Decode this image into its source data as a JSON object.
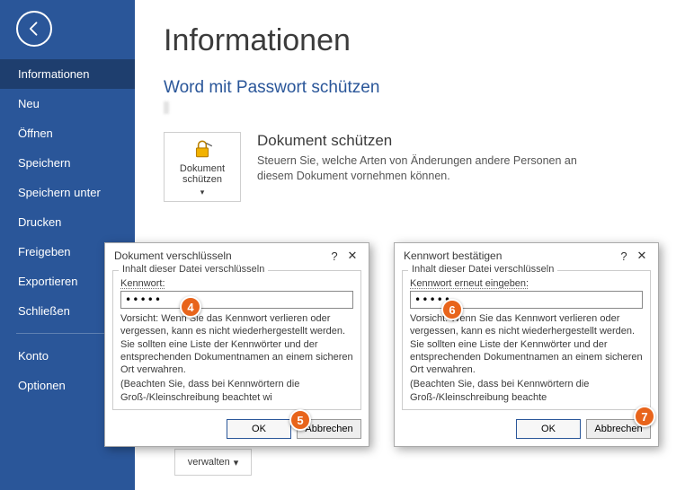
{
  "sidebar": {
    "items": [
      {
        "label": "Informationen",
        "active": true
      },
      {
        "label": "Neu"
      },
      {
        "label": "Öffnen"
      },
      {
        "label": "Speichern"
      },
      {
        "label": "Speichern unter"
      },
      {
        "label": "Drucken"
      },
      {
        "label": "Freigeben"
      },
      {
        "label": "Exportieren"
      },
      {
        "label": "Schließen"
      }
    ],
    "lower": [
      {
        "label": "Konto"
      },
      {
        "label": "Optionen"
      }
    ]
  },
  "main": {
    "title": "Informationen",
    "sub_link": "Word mit Passwort schützen",
    "protect_button": "Dokument schützen",
    "protect_heading": "Dokument schützen",
    "protect_desc": "Steuern Sie, welche Arten von Änderungen andere Personen an diesem Dokument vornehmen können.",
    "manage_button": "verwalten"
  },
  "dialog1": {
    "title": "Dokument verschlüsseln",
    "legend": "Inhalt dieser Datei verschlüsseln",
    "label": "Kennwort:",
    "value": "•••••",
    "warn": "Vorsicht: Wenn Sie das Kennwort verlieren oder vergessen, kann es nicht wiederhergestellt werden. Sie sollten eine Liste der Kennwörter und der entsprechenden Dokumentnamen an einem sicheren Ort verwahren.",
    "note": "(Beachten Sie, dass bei Kennwörtern die Groß-/Kleinschreibung beachtet wi",
    "ok": "OK",
    "cancel": "Abbrechen"
  },
  "dialog2": {
    "title": "Kennwort bestätigen",
    "legend": "Inhalt dieser Datei verschlüsseln",
    "label": "Kennwort erneut eingeben:",
    "value": "•••••",
    "warn": "Vorsicht: Wenn Sie das Kennwort verlieren oder vergessen, kann es nicht wiederhergestellt werden. Sie sollten eine Liste der Kennwörter und der entsprechenden Dokumentnamen an einem sicheren Ort verwahren.",
    "note": "(Beachten Sie, dass bei Kennwörtern die Groß-/Kleinschreibung beachte",
    "ok": "OK",
    "cancel": "Abbrechen"
  },
  "markers": {
    "m4": "4",
    "m5": "5",
    "m6": "6",
    "m7": "7"
  }
}
